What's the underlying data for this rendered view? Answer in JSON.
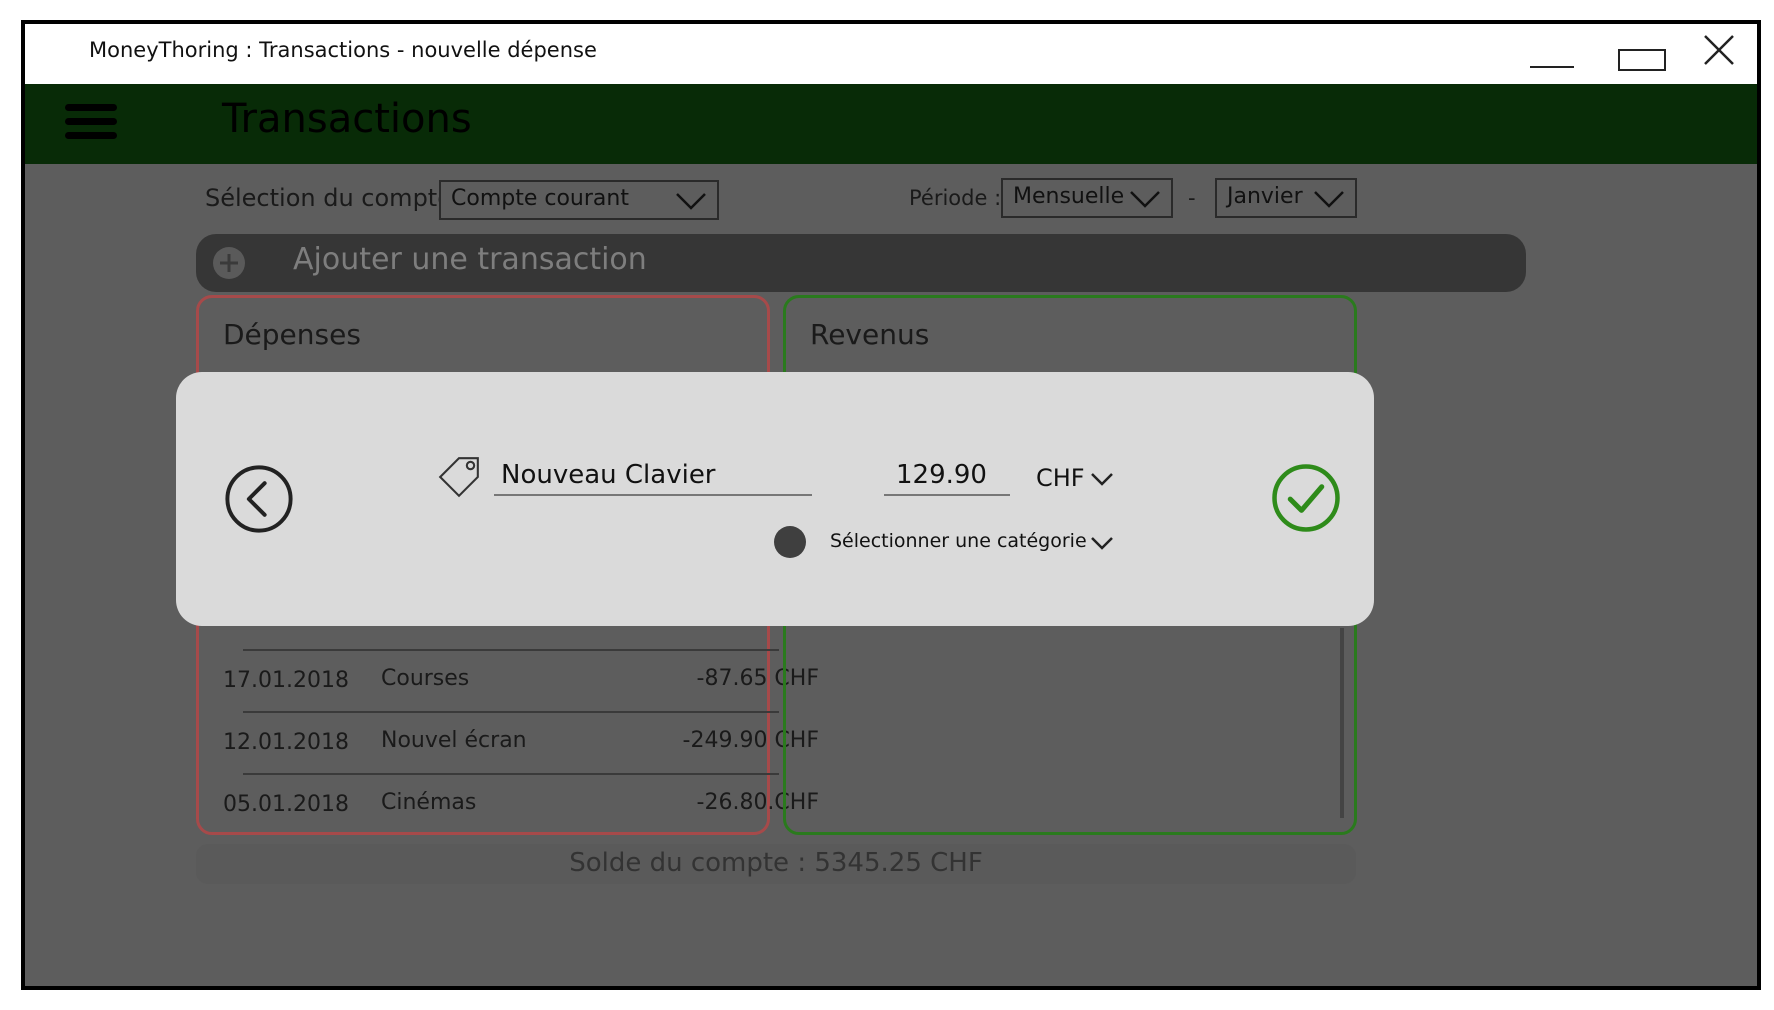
{
  "window": {
    "title": "MoneyThoring : Transactions - nouvelle dépense"
  },
  "appbar": {
    "title": "Transactions"
  },
  "filters": {
    "account_label": "Sélection du compte :",
    "account_value": "Compte courant",
    "period_label": "Période :",
    "period_value": "Mensuelle",
    "separator": "-",
    "month_value": "Janvier"
  },
  "add_transaction": {
    "label": "Ajouter une transaction"
  },
  "expenses": {
    "title": "Dépenses",
    "rows": [
      {
        "date": "17.01.2018",
        "name": "Courses",
        "amount": "-87.65 CHF"
      },
      {
        "date": "12.01.2018",
        "name": "Nouvel écran",
        "amount": "-249.90 CHF"
      },
      {
        "date": "05.01.2018",
        "name": "Cinémas",
        "amount": "-26.80.CHF"
      }
    ]
  },
  "income": {
    "title": "Revenus"
  },
  "balance": {
    "text": "Solde du compte : 5345.25 CHF"
  },
  "modal": {
    "name_value": "Nouveau Clavier",
    "amount_value": "129.90",
    "currency": "CHF",
    "category_placeholder": "Sélectionner une catégorie"
  },
  "colors": {
    "appbar": "#082b07",
    "overlay_bg": "#5d5d5d",
    "expenses_border": "#a64a4a",
    "income_border": "#2a7a1d",
    "confirm": "#2e8b1a",
    "modal_bg": "#dadada"
  },
  "icons": [
    "close-icon",
    "minimize-icon",
    "maximize-icon",
    "hamburger-icon",
    "chevron-down-icon",
    "plus-circle-icon",
    "back-arrow-icon",
    "tag-icon",
    "check-circle-icon"
  ]
}
